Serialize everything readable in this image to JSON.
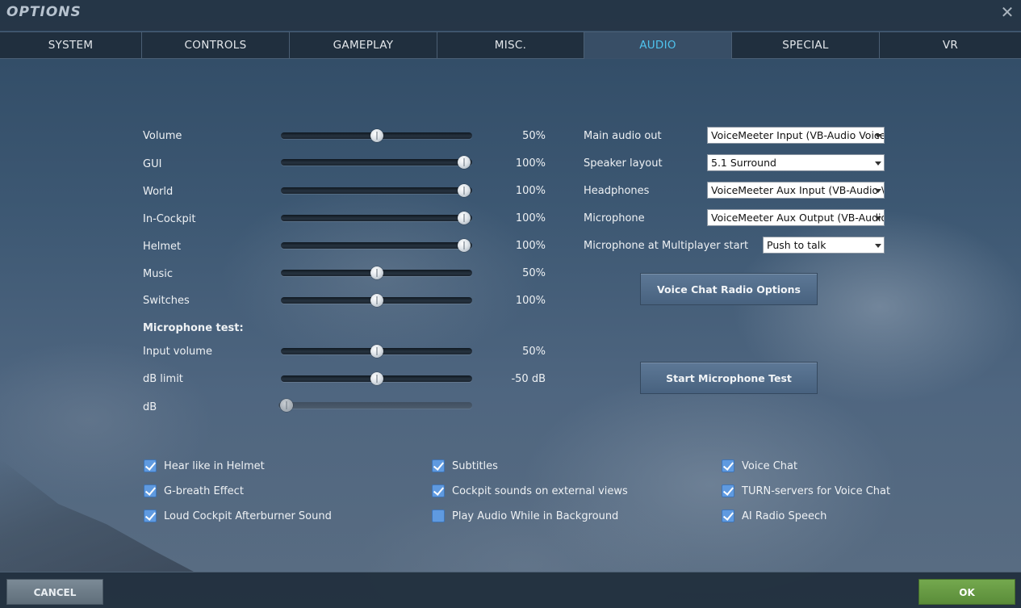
{
  "window": {
    "title": "OPTIONS",
    "close_glyph": "✕"
  },
  "tabs": [
    {
      "label": "SYSTEM",
      "active": false
    },
    {
      "label": "CONTROLS",
      "active": false
    },
    {
      "label": "GAMEPLAY",
      "active": false
    },
    {
      "label": "MISC.",
      "active": false
    },
    {
      "label": "AUDIO",
      "active": true
    },
    {
      "label": "SPECIAL",
      "active": false
    },
    {
      "label": "VR",
      "active": false
    }
  ],
  "sliders": [
    {
      "label": "Volume",
      "value_text": "50%",
      "level": 0.5
    },
    {
      "label": "GUI",
      "value_text": "100%",
      "level": 1.0
    },
    {
      "label": "World",
      "value_text": "100%",
      "level": 1.0
    },
    {
      "label": "In-Cockpit",
      "value_text": "100%",
      "level": 1.0
    },
    {
      "label": "Helmet",
      "value_text": "100%",
      "level": 1.0
    },
    {
      "label": "Music",
      "value_text": "50%",
      "level": 0.5
    },
    {
      "label": "Switches",
      "value_text": "100%",
      "level": 0.5
    }
  ],
  "mic_test": {
    "heading": "Microphone test:",
    "sliders": [
      {
        "label": "Input volume",
        "value_text": "50%",
        "level": 0.5
      },
      {
        "label": "dB limit",
        "value_text": "-50 dB",
        "level": 0.5
      },
      {
        "label": "dB",
        "value_text": "",
        "level": 0.0,
        "disabled": true
      }
    ]
  },
  "devices": [
    {
      "label": "Main audio out",
      "value": "VoiceMeeter Input (VB-Audio Voice"
    },
    {
      "label": "Speaker layout",
      "value": "5.1 Surround"
    },
    {
      "label": "Headphones",
      "value": "VoiceMeeter Aux Input (VB-Audio \\"
    },
    {
      "label": "Microphone",
      "value": "VoiceMeeter Aux Output (VB-Audio"
    },
    {
      "label": "Microphone at Multiplayer start",
      "value": "Push to talk"
    }
  ],
  "buttons": {
    "voice_chat_radio": "Voice Chat Radio Options",
    "start_mic_test": "Start Microphone Test",
    "cancel": "CANCEL",
    "ok": "OK"
  },
  "checkboxes": [
    {
      "label": "Hear like in Helmet",
      "checked": true
    },
    {
      "label": "G-breath Effect",
      "checked": true
    },
    {
      "label": "Loud Cockpit Afterburner Sound",
      "checked": true
    },
    {
      "label": "Subtitles",
      "checked": true
    },
    {
      "label": "Cockpit sounds on external views",
      "checked": true
    },
    {
      "label": "Play Audio While in Background",
      "checked": false
    },
    {
      "label": "Voice Chat",
      "checked": true
    },
    {
      "label": "TURN-servers for Voice Chat",
      "checked": true
    },
    {
      "label": "AI Radio Speech",
      "checked": true
    }
  ],
  "colors": {
    "active_tab_text": "#4fc3ee",
    "checkbox_fill": "#5f9ae0",
    "ok_button": "#6a9c45",
    "panel_button": "#54708e"
  }
}
